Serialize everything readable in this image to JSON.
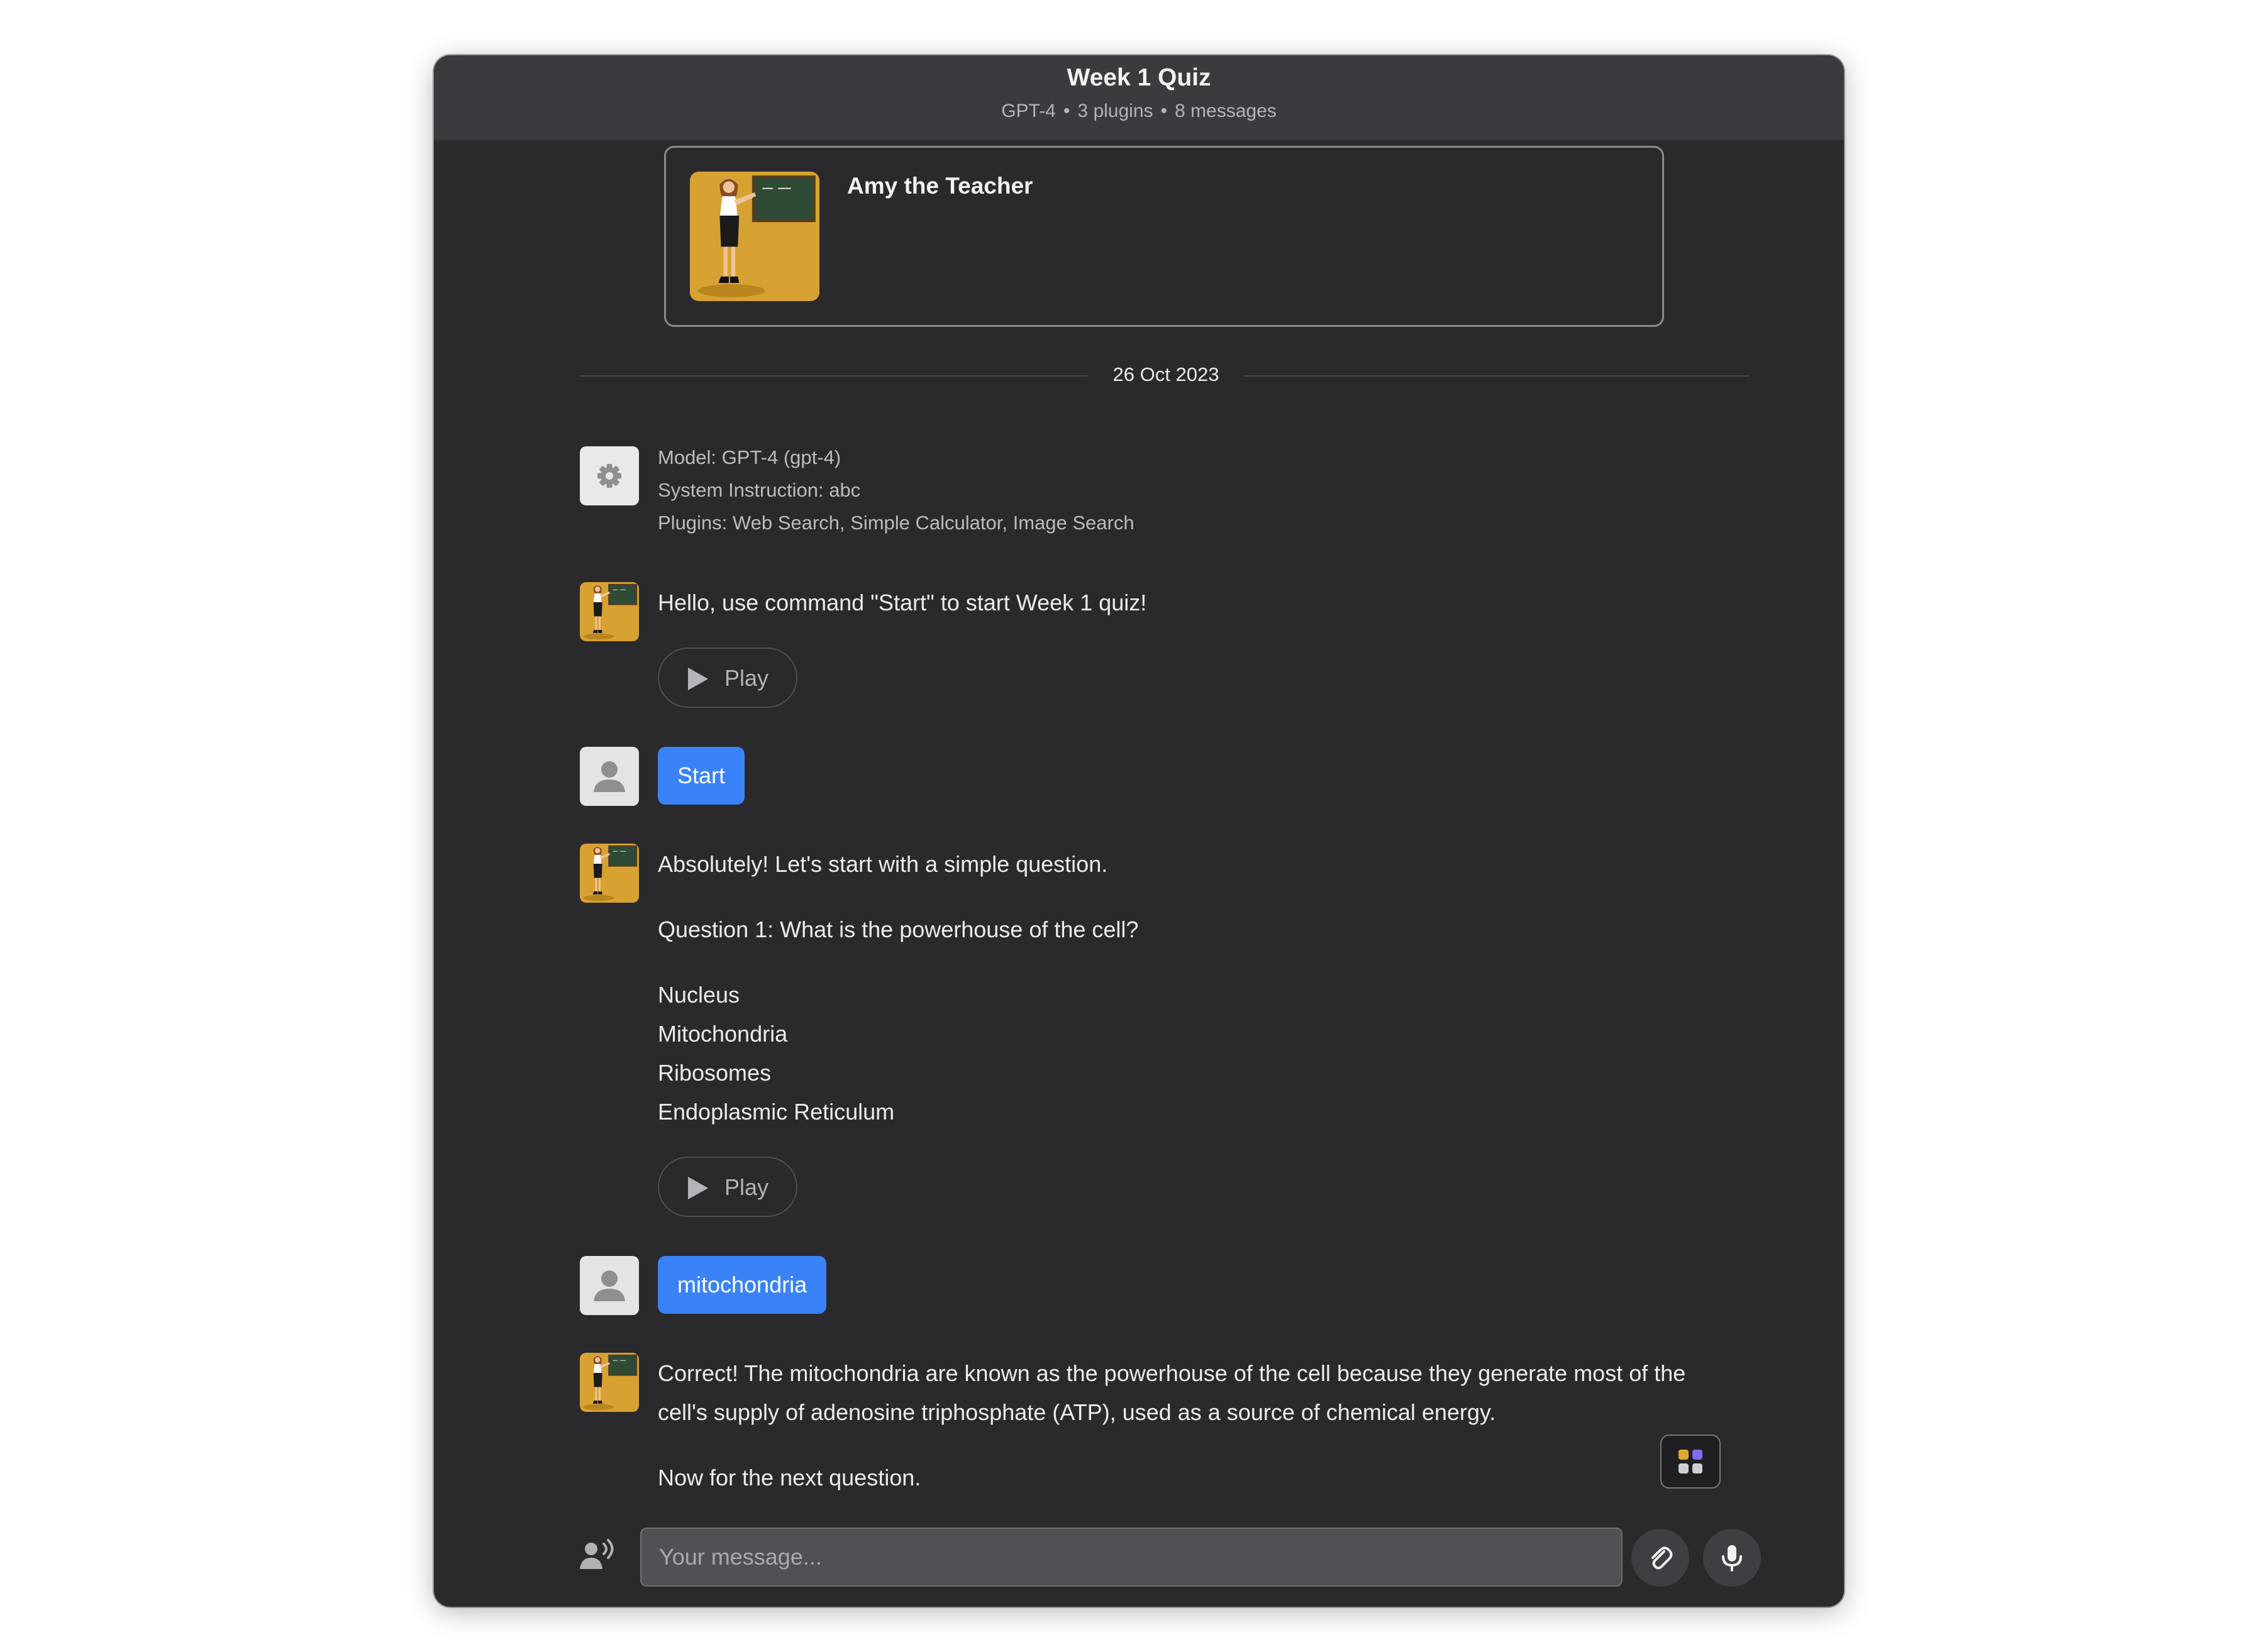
{
  "header": {
    "title": "Week 1 Quiz",
    "model": "GPT-4",
    "plugins_count": "3 plugins",
    "messages_count": "8 messages",
    "separator": "•"
  },
  "persona": {
    "name": "Amy the Teacher",
    "avatar_icon": "teacher-at-chalkboard-icon",
    "chalkboard_text": "E=mc²"
  },
  "date_divider": "26 Oct 2023",
  "system_message": {
    "icon": "gear-icon",
    "lines": [
      "Model: GPT-4 (gpt-4)",
      "System Instruction: abc",
      "Plugins: Web Search, Simple Calculator, Image Search"
    ]
  },
  "messages": [
    {
      "role": "assistant",
      "lines": [
        "Hello, use command \"Start\" to start Week 1 quiz!"
      ],
      "play_label": "Play"
    },
    {
      "role": "user",
      "text": "Start"
    },
    {
      "role": "assistant",
      "lines": [
        "Absolutely! Let's start with a simple question.",
        "Question 1: What is the powerhouse of the cell?",
        "Nucleus",
        "Mitochondria",
        "Ribosomes",
        "Endoplasmic Reticulum"
      ],
      "play_label": "Play"
    },
    {
      "role": "user",
      "text": "mitochondria"
    },
    {
      "role": "assistant",
      "lines": [
        "Correct! The mitochondria are known as the powerhouse of the cell because they generate most of the",
        "cell's supply of adenosine triphosphate (ATP), used as a source of chemical energy.",
        "Now for the next question."
      ]
    }
  ],
  "composer": {
    "placeholder": "Your message...",
    "value": "",
    "voice_icon": "voice-speaking-icon",
    "attach_icon": "paperclip-icon",
    "mic_icon": "microphone-icon"
  },
  "apps_button_icon": "apps-grid-icon",
  "colors": {
    "window_bg": "#2a2a2d",
    "header_bg": "#3b3b3f",
    "user_bubble": "#3a82f7",
    "avatar_gold": "#d8a232",
    "chalkboard": "#2f4a35"
  }
}
